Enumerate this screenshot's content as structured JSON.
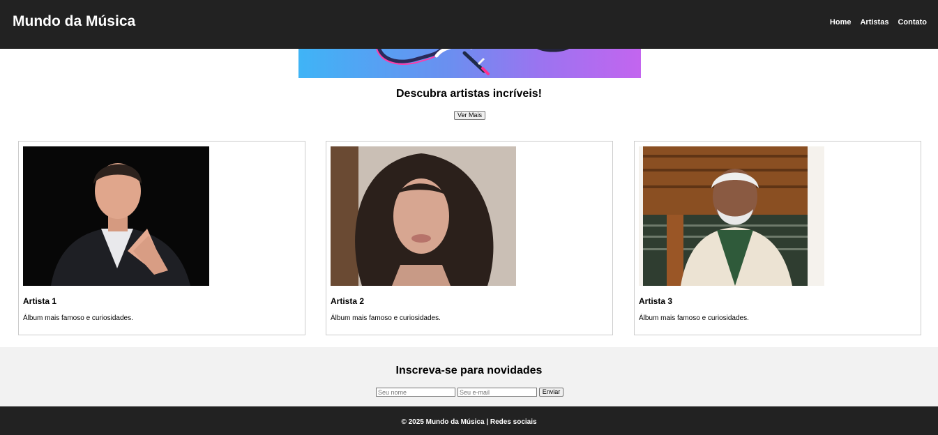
{
  "header": {
    "brand": "Mundo da Música",
    "nav": [
      {
        "label": "Home"
      },
      {
        "label": "Artistas"
      },
      {
        "label": "Contato"
      }
    ]
  },
  "hero": {
    "image_icon": "headphones-image",
    "title": "Descubra artistas incríveis!",
    "button_label": "Ver Mais"
  },
  "artists": [
    {
      "name": "Artista 1",
      "description": "Álbum mais famoso e curiosidades.",
      "photo_icon": "artist-photo"
    },
    {
      "name": "Artista 2",
      "description": "Álbum mais famoso e curiosidades.",
      "photo_icon": "artist-photo"
    },
    {
      "name": "Artista 3",
      "description": "Álbum mais famoso e curiosidades.",
      "photo_icon": "artist-photo"
    }
  ],
  "newsletter": {
    "title": "Inscreva-se para novidades",
    "name_placeholder": "Seu nome",
    "email_placeholder": "Seu e-mail",
    "submit_label": "Enviar"
  },
  "footer": {
    "text": "© 2025 Mundo da Música | Redes sociais"
  },
  "colors": {
    "header_bg": "#222222",
    "newsletter_bg": "#f2f2f2",
    "card_border": "#cccccc"
  }
}
